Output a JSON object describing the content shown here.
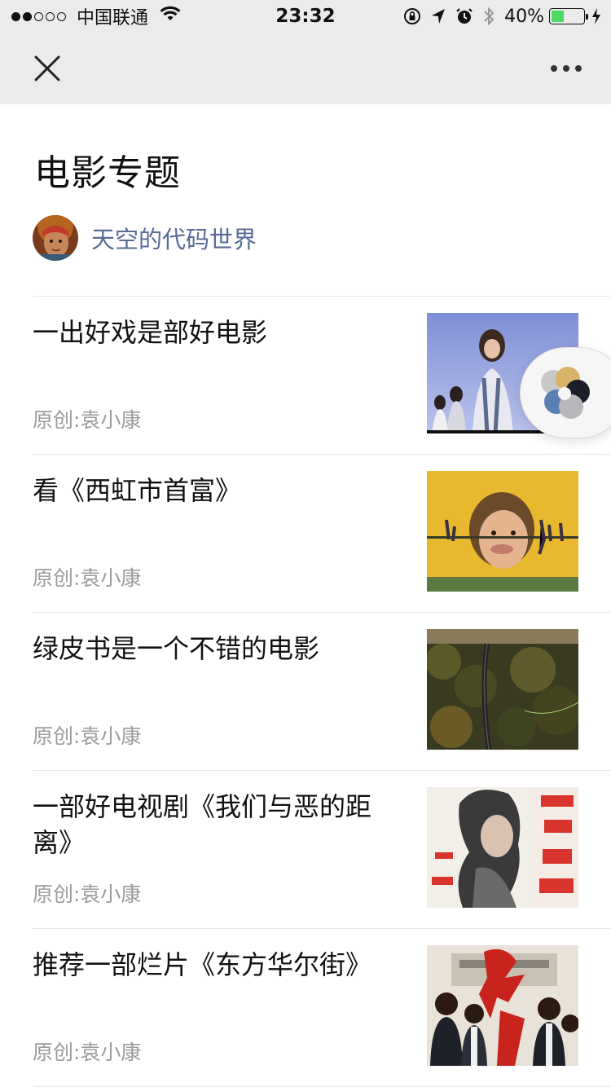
{
  "status_bar": {
    "carrier": "中国联通",
    "time": "23:32",
    "battery_percent": "40%",
    "battery_level": 0.4,
    "signal_bars": 2
  },
  "nav": {
    "close_icon": "close-icon",
    "more_icon": "more-dots-icon"
  },
  "page": {
    "title": "电影专题",
    "author": {
      "name": "天空的代码世界",
      "color": "#576b95"
    }
  },
  "articles": [
    {
      "title": "一出好戏是部好电影",
      "source": "原创:袁小康",
      "thumb": "movie-still-girl"
    },
    {
      "title": "看《西虹市首富》",
      "source": "原创:袁小康",
      "thumb": "movie-poster-rich-man"
    },
    {
      "title": "绿皮书是一个不错的电影",
      "source": "原创:袁小康",
      "thumb": "forest-road-aerial"
    },
    {
      "title": "一部好电视剧《我们与恶的距离》",
      "source": "原创:袁小康",
      "thumb": "drama-poster"
    },
    {
      "title": "推荐一部烂片《东方华尔街》",
      "source": "原创:袁小康",
      "thumb": "movie-poster-men-suits"
    }
  ]
}
